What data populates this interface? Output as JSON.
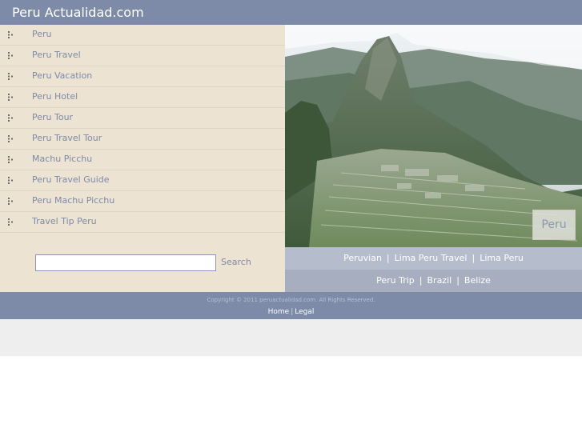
{
  "header": {
    "title": "Peru Actualidad.com"
  },
  "sidebar": {
    "items": [
      {
        "label": "Peru"
      },
      {
        "label": "Peru Travel"
      },
      {
        "label": "Peru Vacation"
      },
      {
        "label": "Peru Hotel"
      },
      {
        "label": "Peru Tour"
      },
      {
        "label": "Peru Travel Tour"
      },
      {
        "label": "Machu Picchu"
      },
      {
        "label": "Peru Travel Guide"
      },
      {
        "label": "Peru Machu Picchu"
      },
      {
        "label": "Travel Tip Peru"
      }
    ],
    "search": {
      "value": "",
      "placeholder": "",
      "button_label": "Search"
    }
  },
  "photo": {
    "caption": "Peru"
  },
  "links": {
    "row1": [
      {
        "label": "Peruvian"
      },
      {
        "label": "Lima Peru Travel"
      },
      {
        "label": "Lima Peru"
      }
    ],
    "row2": [
      {
        "label": "Peru Trip"
      },
      {
        "label": "Brazil"
      },
      {
        "label": "Belize"
      }
    ],
    "separator": "|"
  },
  "footer": {
    "copyright": "Copyright © 2011 peruactualidad.com. All Rights Reserved.",
    "home_label": "Home",
    "legal_label": "Legal",
    "separator": "|"
  },
  "colors": {
    "header_bg": "#7d8aa8",
    "sidebar_bg": "#ede3d2",
    "link_text": "#7d8aa8",
    "row1_bg": "#b5bccc",
    "row2_bg": "#a7aebf"
  },
  "icons": {
    "nav_bullet": "bullet-dots-icon"
  }
}
